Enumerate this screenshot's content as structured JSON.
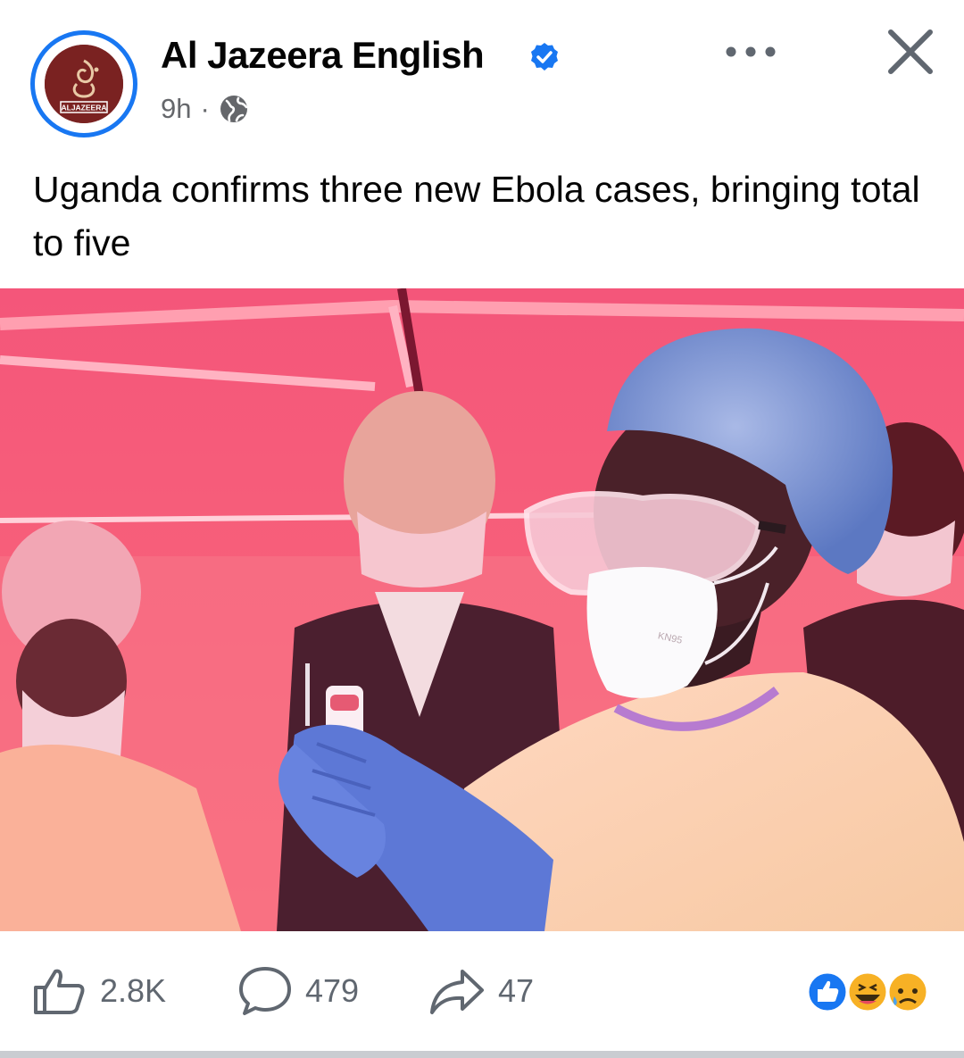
{
  "post": {
    "page_name": "Al Jazeera English",
    "time": "9h",
    "separator": "·",
    "avatar_text": "ALJAZEERA",
    "caption": "Uganda confirms three new Ebola cases, bringing total to five",
    "photo_mask_label": "KN95"
  },
  "icons": {
    "verified": "verified-badge-icon",
    "audience": "globe-icon",
    "more": "more-dots-icon",
    "close": "close-icon",
    "like": "thumbs-up-icon",
    "comment": "comment-bubble-icon",
    "share": "share-arrow-icon",
    "reactions": [
      "like-reaction-icon",
      "haha-reaction-icon",
      "sad-reaction-icon"
    ]
  },
  "engagement": {
    "likes": "2.8K",
    "comments": "479",
    "shares": "47"
  },
  "colors": {
    "accent": "#1877f2",
    "brand": "#7a2221",
    "text_secondary": "#65676b"
  }
}
